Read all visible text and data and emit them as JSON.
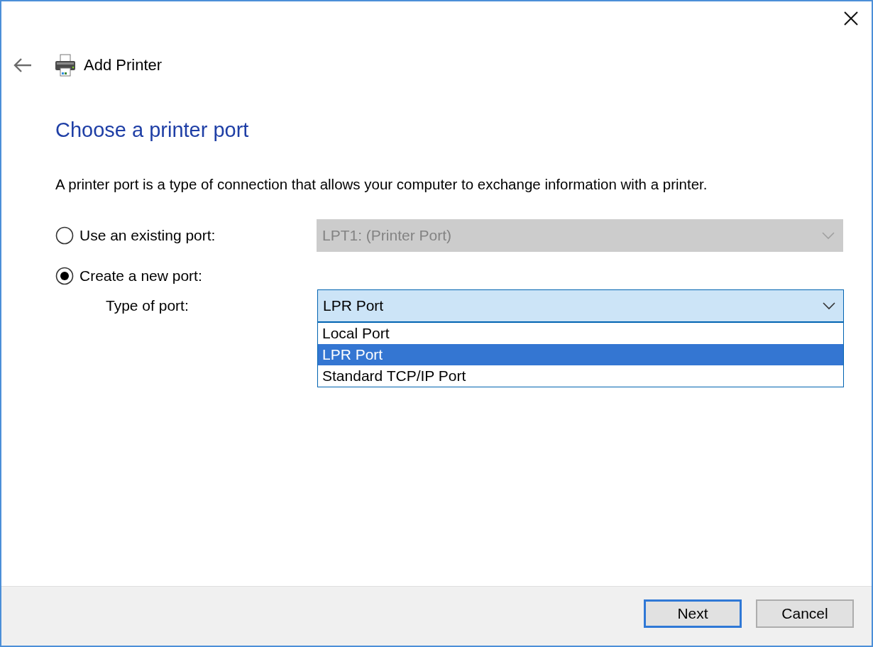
{
  "window": {
    "title": "Add Printer"
  },
  "heading": "Choose a printer port",
  "description": "A printer port is a type of connection that allows your computer to exchange information with a printer.",
  "port_options": [
    {
      "kind": "existing",
      "label": "Use an existing port:",
      "selected": false,
      "combo": {
        "value": "LPT1: (Printer Port)",
        "disabled": true,
        "expanded": false
      }
    },
    {
      "kind": "new",
      "label": "Create a new port:",
      "selected": true,
      "type_label": "Type of port:",
      "combo": {
        "value": "LPR Port",
        "disabled": false,
        "expanded": true,
        "items": [
          {
            "label": "Local Port",
            "selected": false
          },
          {
            "label": "LPR Port",
            "selected": true
          },
          {
            "label": "Standard TCP/IP Port",
            "selected": false
          }
        ]
      }
    }
  ],
  "buttons": [
    {
      "label": "Next",
      "default": true
    },
    {
      "label": "Cancel",
      "default": false
    }
  ]
}
